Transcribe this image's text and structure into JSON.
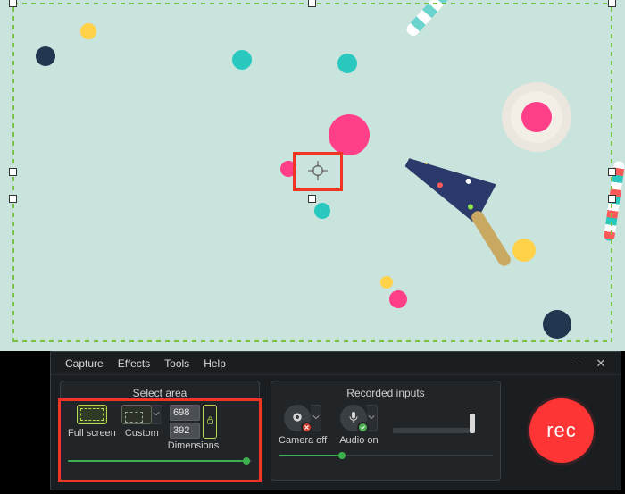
{
  "selection": {
    "width": "698",
    "height": "392"
  },
  "menubar": {
    "capture": "Capture",
    "effects": "Effects",
    "tools": "Tools",
    "help": "Help"
  },
  "groups": {
    "select_area": "Select area",
    "recorded_inputs": "Recorded inputs"
  },
  "area": {
    "full_screen": "Full screen",
    "custom": "Custom",
    "dimensions": "Dimensions"
  },
  "inputs": {
    "camera": "Camera off",
    "audio": "Audio on"
  },
  "rec_label": "rec",
  "sliders": {
    "select_area_pct": 95,
    "recorded_inputs_pct": 28
  },
  "colors": {
    "accent_green": "#7ac142",
    "highlight_red": "#f03524",
    "rec_red": "#ff3434"
  }
}
